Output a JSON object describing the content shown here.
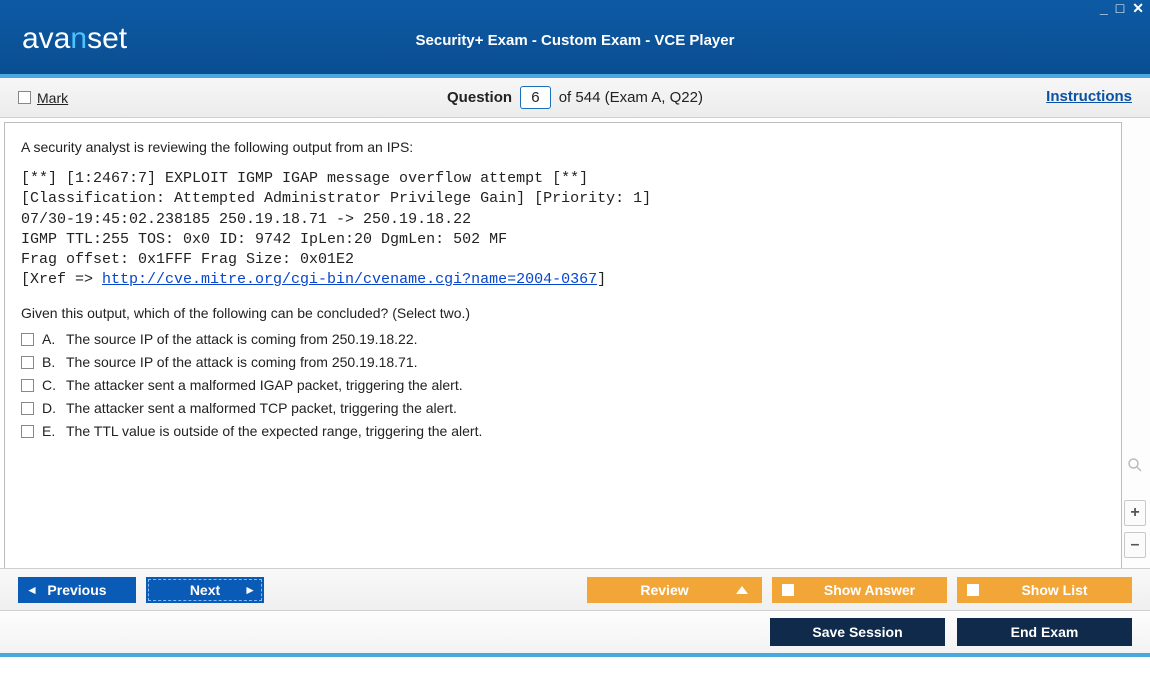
{
  "titlebar": {
    "logo_left": "ava",
    "logo_mid": "n",
    "logo_right": "set",
    "title": "Security+ Exam - Custom Exam - VCE Player"
  },
  "toolbar": {
    "mark_label": "Mark",
    "question_word": "Question",
    "question_num": "6",
    "question_total_context": "of 544 (Exam A, Q22)",
    "instructions_label": "Instructions"
  },
  "question": {
    "intro": "A security analyst is reviewing the following output from an IPS:",
    "ips_line1": "[**] [1:2467:7] EXPLOIT IGMP IGAP message overflow attempt [**]",
    "ips_line2": "[Classification: Attempted Administrator Privilege Gain] [Priority: 1]",
    "ips_line3": "07/30-19:45:02.238185 250.19.18.71 -> 250.19.18.22",
    "ips_line4": "IGMP TTL:255 TOS: 0x0 ID: 9742 IpLen:20 DgmLen: 502 MF",
    "ips_line5": "Frag offset: 0x1FFF Frag Size: 0x01E2",
    "ips_line6_pre": "[Xref => ",
    "ips_line6_link": "http://cve.mitre.org/cgi-bin/cvename.cgi?name=2004-0367",
    "ips_line6_post": "]",
    "prompt": "Given this output, which of the following can be concluded? (Select two.)",
    "options": [
      {
        "letter": "A.",
        "text": "The source IP of the attack is coming from 250.19.18.22."
      },
      {
        "letter": "B.",
        "text": "The source IP of the attack is coming from 250.19.18.71."
      },
      {
        "letter": "C.",
        "text": "The attacker sent a malformed IGAP packet, triggering the alert."
      },
      {
        "letter": "D.",
        "text": "The attacker sent a malformed TCP packet, triggering the alert."
      },
      {
        "letter": "E.",
        "text": "The TTL value is outside of the expected range, triggering the alert."
      }
    ]
  },
  "nav": {
    "previous": "Previous",
    "next": "Next",
    "review": "Review",
    "show_answer": "Show Answer",
    "show_list": "Show List",
    "save_session": "Save Session",
    "end_exam": "End Exam"
  }
}
